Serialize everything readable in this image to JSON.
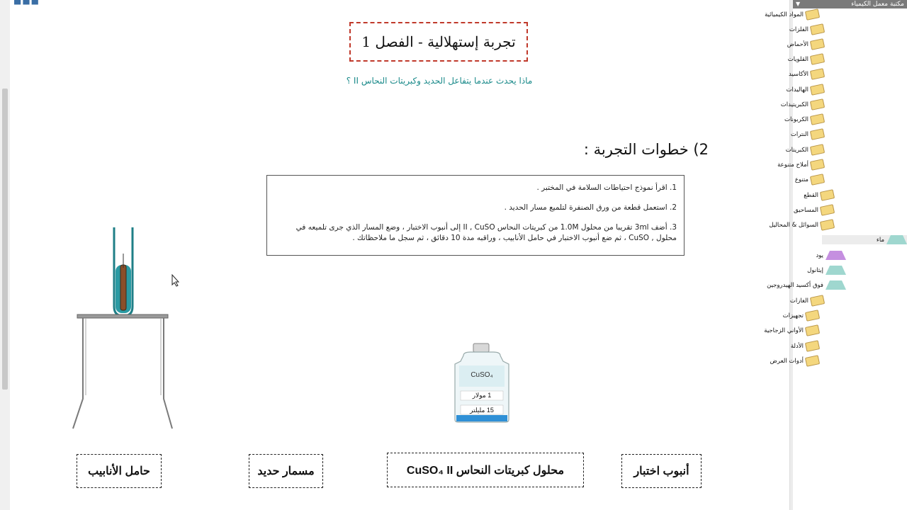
{
  "experiment": {
    "title": "تجربة إستهلالية - الفصل 1",
    "question": "ماذا يحدث عندما يتفاعل الحديد وكبريتات النحاس II ؟",
    "steps_heading": "2) خطوات التجربة :",
    "steps": [
      "1. اقرأ نموذج احتياطات السلامة في المختبر .",
      "2. استعمل قطعة من ورق الصنفرة لتلميع مسار الحديد .",
      "3. أضف 3ml تقريبا من محلول 1.0M من كبريتات النحاس II , CuSO إلى أنبوب الاختبار ، وضع المسار الذي جرى تلميعه في محلول , CuSO ، ثم ضع أنبوب الاختبار في حامل الأنابيب ، وراقبه مدة 10 دقائق ، ثم سجل ما ملاحظاتك ."
    ]
  },
  "labels": {
    "test_tube": "أنبوب اختبار",
    "cuso4_solution": "محلول كبريتات النحاس CuSO₄ II",
    "iron_nail": "مسمار حديد",
    "tube_stand": "حامل الأنابيب"
  },
  "bottle": {
    "formula": "CuSO₄",
    "molarity": "1 مولار",
    "volume": "15 ملیلتر"
  },
  "library": {
    "title": "مكتبة معمل الكيمياء",
    "items": [
      {
        "label": "المواد الكيميائية",
        "icon": "folder-icon"
      },
      {
        "label": "الفلزات",
        "icon": "metals-icon"
      },
      {
        "label": "الأحماض",
        "icon": "acids-icon"
      },
      {
        "label": "القلويات",
        "icon": "bases-icon"
      },
      {
        "label": "الأكاسيد",
        "icon": "oxides-icon"
      },
      {
        "label": "الهاليدات",
        "icon": "halides-icon"
      },
      {
        "label": "الكبريتيدات",
        "icon": "sulfides-icon"
      },
      {
        "label": "الكربونات",
        "icon": "carbonates-icon"
      },
      {
        "label": "النترات",
        "icon": "nitrates-icon"
      },
      {
        "label": "الكبريتات",
        "icon": "sulfates-icon"
      },
      {
        "label": "أملاح متنوعة",
        "icon": "salts-icon"
      },
      {
        "label": "متنوع",
        "icon": "folder-icon"
      },
      {
        "label": "القطع",
        "icon": "folder-icon"
      },
      {
        "label": "المساحيق",
        "icon": "folder-icon"
      },
      {
        "label": "السوائل & المحاليل",
        "icon": "folder-icon"
      },
      {
        "label": "ماء",
        "icon": "flask-icon"
      },
      {
        "label": "يود",
        "icon": "flask-icon"
      },
      {
        "label": "إيثانول",
        "icon": "flask-icon"
      },
      {
        "label": "فوق أكسيد الهيدروجين",
        "icon": "flask-icon"
      },
      {
        "label": "الغازات",
        "icon": "folder-icon"
      },
      {
        "label": "تجهيزات",
        "icon": "equipment-icon"
      },
      {
        "label": "الأواني الزجاجية",
        "icon": "glassware-icon"
      },
      {
        "label": "الأدلة",
        "icon": "indicators-icon"
      },
      {
        "label": "أدوات العرض",
        "icon": "display-tools-icon"
      }
    ]
  }
}
